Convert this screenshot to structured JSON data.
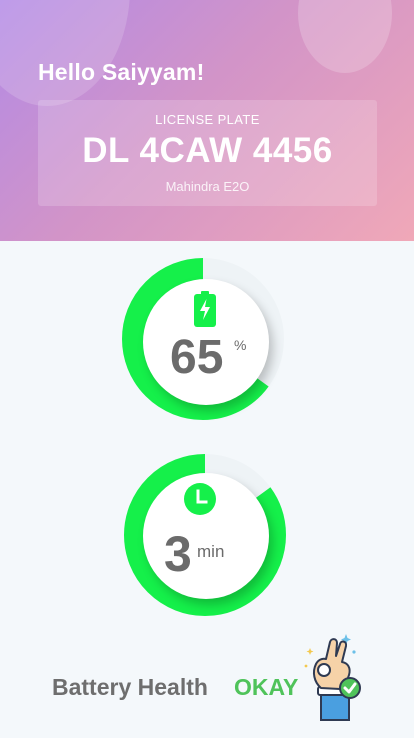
{
  "header": {
    "greeting": "Hello Saiyyam!",
    "plate_label": "LICENSE PLATE",
    "plate_number": "DL 4CAW 4456",
    "vehicle_model": "Mahindra E2O"
  },
  "battery": {
    "value": "65",
    "unit": "%",
    "level": 0.65,
    "icon": "battery-charging-icon"
  },
  "time": {
    "value": "3",
    "unit": "min",
    "level": 0.85,
    "icon": "clock-icon"
  },
  "footer": {
    "label": "Battery Health",
    "status": "OKAY",
    "icon": "ok-hand-icon"
  },
  "colors": {
    "accent_green": "#15f04a",
    "status_green": "#4fc35a",
    "header_gradient_start": "#b28ae6",
    "header_gradient_end": "#f0a8b8"
  }
}
